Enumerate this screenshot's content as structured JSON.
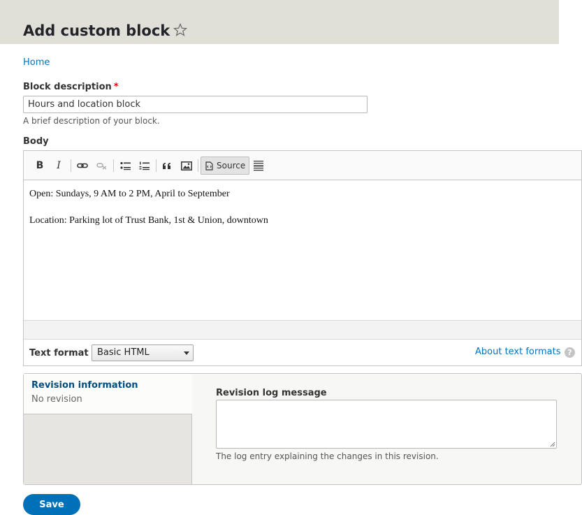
{
  "page": {
    "title": "Add custom block",
    "star_icon": "star-outline-icon"
  },
  "breadcrumb": {
    "home": "Home"
  },
  "block_description": {
    "label": "Block description",
    "required_marker": "*",
    "value": "Hours and location block",
    "help": "A brief description of your block."
  },
  "body": {
    "label": "Body",
    "toolbar": {
      "bold": "B",
      "italic": "I",
      "source": "Source",
      "icons": [
        "bold-icon",
        "italic-icon",
        "link-icon",
        "unlink-icon",
        "bulleted-list-icon",
        "numbered-list-icon",
        "blockquote-icon",
        "image-icon",
        "source-icon",
        "horizontal-rule-icon"
      ]
    },
    "paragraphs": [
      "Open: Sundays, 9 AM to 2 PM, April to September",
      "Location: Parking lot of Trust Bank, 1st & Union, downtown"
    ]
  },
  "text_format": {
    "label": "Text format",
    "selected": "Basic HTML",
    "about_link": "About text formats",
    "help_glyph": "?"
  },
  "revision": {
    "tab_title": "Revision information",
    "tab_summary": "No revision",
    "log_label": "Revision log message",
    "log_value": "",
    "log_help": "The log entry explaining the changes in this revision."
  },
  "actions": {
    "save": "Save"
  },
  "colors": {
    "link": "#0074bd",
    "primary_button": "#0071b8",
    "required": "#ee0000",
    "header_bg": "#e0e0d8"
  }
}
